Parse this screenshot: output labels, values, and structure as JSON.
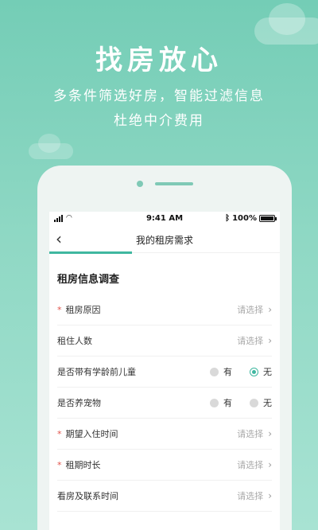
{
  "hero": {
    "title": "找房放心",
    "subtitle_line1": "多条件筛选好房，智能过滤信息",
    "subtitle_line2": "杜绝中介费用"
  },
  "status_bar": {
    "time": "9:41 AM",
    "battery": "100%",
    "bluetooth_icon": "bluetooth-icon"
  },
  "nav": {
    "back_icon": "chevron-left-icon",
    "title": "我的租房需求",
    "progress": 0.5
  },
  "section": {
    "title": "租房信息调查"
  },
  "rows": [
    {
      "label": "租房原因",
      "required": true,
      "type": "select",
      "placeholder": "请选择"
    },
    {
      "label": "租住人数",
      "required": false,
      "type": "select",
      "placeholder": "请选择"
    },
    {
      "label": "是否带有学龄前儿童",
      "required": false,
      "type": "radio",
      "options": [
        "有",
        "无"
      ],
      "selected": "无"
    },
    {
      "label": "是否养宠物",
      "required": false,
      "type": "radio",
      "options": [
        "有",
        "无"
      ],
      "selected": ""
    },
    {
      "label": "期望入住时间",
      "required": true,
      "type": "select",
      "placeholder": "请选择"
    },
    {
      "label": "租期时长",
      "required": true,
      "type": "select",
      "placeholder": "请选择"
    },
    {
      "label": "看房及联系时间",
      "required": false,
      "type": "select",
      "placeholder": "请选择"
    }
  ],
  "colors": {
    "accent": "#3fb7a0",
    "required": "#e0524a",
    "background": "#74cdb6"
  }
}
